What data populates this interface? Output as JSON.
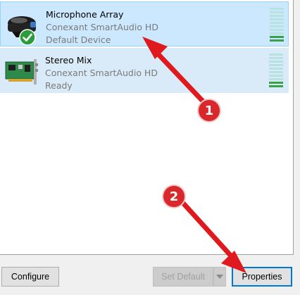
{
  "devices": [
    {
      "name": "Microphone Array",
      "driver": "Conexant SmartAudio HD",
      "status": "Default Device",
      "icon": "microphone-icon",
      "is_default": true,
      "selected": true
    },
    {
      "name": "Stereo Mix",
      "driver": "Conexant SmartAudio HD",
      "status": "Ready",
      "icon": "sound-card-icon",
      "is_default": false,
      "selected": false
    }
  ],
  "buttons": {
    "configure": "Configure",
    "set_default": "Set Default",
    "properties": "Properties"
  },
  "callouts": {
    "first": "1",
    "second": "2"
  },
  "colors": {
    "selection_bg": "#cce8ff",
    "row_bg": "#d9ebf9",
    "meter_off": "#b7e2e0",
    "meter_on": "#3aa04a",
    "callout_red": "#d9282b",
    "default_check_green": "#2a9d3a"
  }
}
